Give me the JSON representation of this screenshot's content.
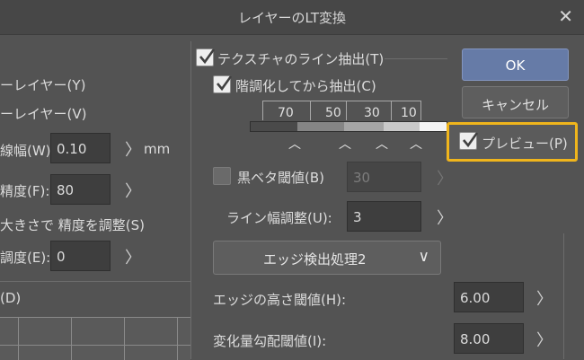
{
  "dialog": {
    "title": "レイヤーのLT変換",
    "close_glyph": "✕"
  },
  "left": {
    "row1": "ーレイヤー(Y)",
    "row2": "ーレイヤー(V)",
    "width_label": "線幅(W):",
    "width_value": "0.10",
    "width_unit": "mm",
    "precision_label": "精度(F):",
    "precision_value": "80",
    "auto_adjust_label": "大きさで 精度を調整(S)",
    "tone_label": "調度(E):",
    "tone_value": "0",
    "section_label": "(D)"
  },
  "texture": {
    "label": "テクスチャのライン抽出(T)",
    "checked": true,
    "gradation_label": "階調化してから抽出(C)",
    "gradation_checked": true,
    "levels": [
      "70",
      "50",
      "30",
      "10"
    ]
  },
  "black": {
    "label": "黒ベタ閾値(B)",
    "checked": false,
    "value": "30"
  },
  "line_width_adjust": {
    "label": "ライン幅調整(U):",
    "value": "3"
  },
  "edge_mode": {
    "selected": "エッジ検出処理2"
  },
  "edge_height": {
    "label": "エッジの高さ閾値(H):",
    "value": "6.00"
  },
  "gradient": {
    "label": "変化量勾配閾値(I):",
    "value": "8.00"
  },
  "buttons": {
    "ok": "OK",
    "cancel": "キャンセル",
    "preview": "プレビュー(P)",
    "preview_checked": true
  },
  "glyphs": {
    "arrow_right": "〉",
    "caret_up": "︿",
    "chevron_down": "∨"
  },
  "colors": {
    "highlight": "#f0b51c",
    "ok_button": "#667ba7"
  }
}
